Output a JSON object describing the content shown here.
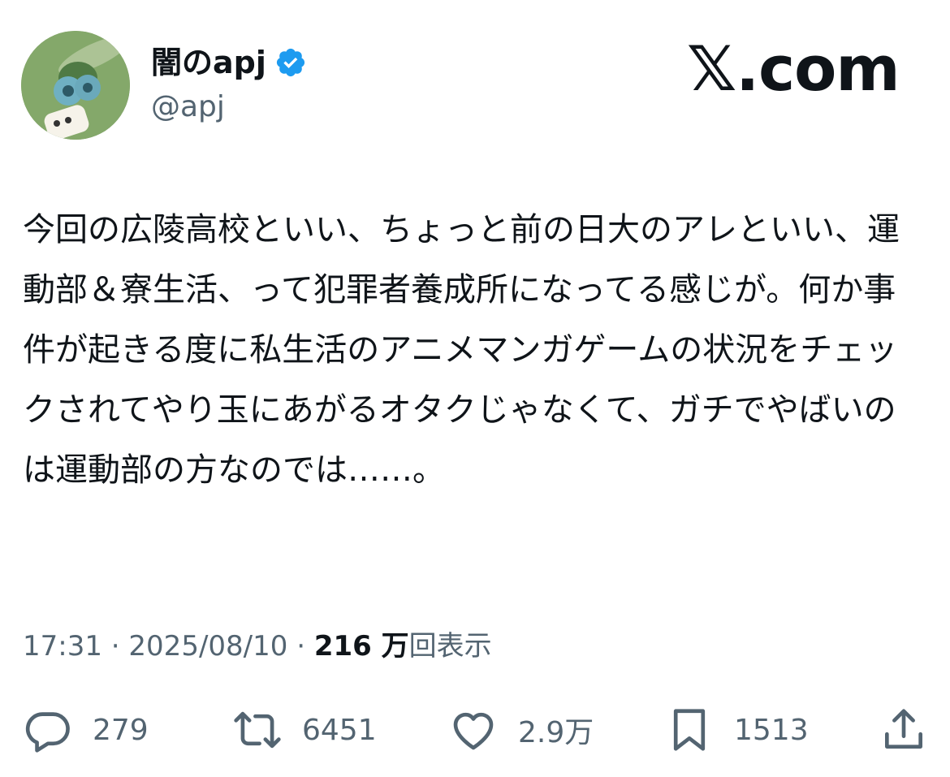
{
  "user": {
    "display_name": "闇のapj",
    "handle": "@apj",
    "verified": true,
    "avatar": "dragonfly-avatar"
  },
  "brand": {
    "text": "𝕏.com"
  },
  "tweet": {
    "text": "今回の広陵高校といい、ちょっと前の日大のアレといい、運動部＆寮生活、って犯罪者養成所になってる感じが。何か事件が起きる度に私生活のアニメマンガゲームの状況をチェックされてやり玉にあがるオタクじゃなくて、ガチでやばいのは運動部の方なのでは……。",
    "time": "17:31",
    "separator": " · ",
    "date": "2025/08/10",
    "views_count": "216 万",
    "views_label": "回表示"
  },
  "actions": {
    "reply": {
      "icon": "reply-icon",
      "count": "279"
    },
    "retweet": {
      "icon": "retweet-icon",
      "count": "6451"
    },
    "like": {
      "icon": "heart-icon",
      "count": "2.9万"
    },
    "bookmark": {
      "icon": "bookmark-icon",
      "count": "1513"
    },
    "share": {
      "icon": "share-icon"
    }
  },
  "colors": {
    "text": "#0f1419",
    "secondary": "#536471",
    "verified": "#1d9bf0"
  }
}
